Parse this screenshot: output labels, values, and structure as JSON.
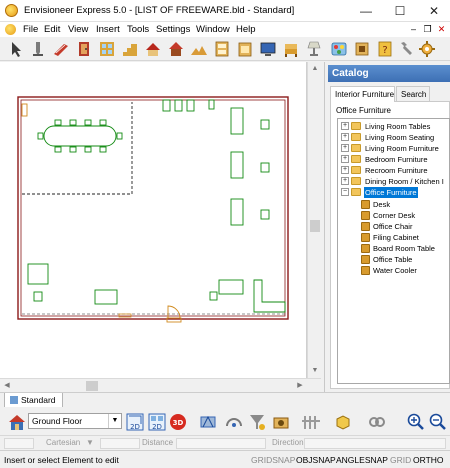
{
  "window": {
    "title": "Envisioneer Express 5.0 - [LIST OF FREEWARE.bld - Standard]",
    "minimize": "—",
    "maximize": "☐",
    "close": "✕"
  },
  "menu": {
    "items": [
      "File",
      "Edit",
      "View",
      "Insert",
      "Tools",
      "Settings",
      "Window",
      "Help"
    ],
    "mdi_min": "–",
    "mdi_restore": "❐",
    "mdi_close": "✕"
  },
  "toolbar": {
    "icons": [
      "select-arrow-icon",
      "pencil-icon",
      "wall-icon",
      "door-icon",
      "window-icon",
      "stairs-icon",
      "roof-icon",
      "terrain-icon",
      "cabinet-icon",
      "appliance-icon",
      "monitor-icon",
      "furniture-icon",
      "lamp-icon",
      "paint-icon",
      "help-icon",
      "tools-icon",
      "settings-icon"
    ]
  },
  "canvas": {
    "scroll_up": "▲",
    "scroll_down": "▼",
    "scroll_left": "◀",
    "scroll_right": "▶",
    "colors": {
      "wall": "#8b1a1a",
      "furniture": "#128a12",
      "door": "#d08a1e",
      "dashed": "#222222"
    }
  },
  "catalog": {
    "title": "Catalog",
    "tabs": [
      "Interior Furniture",
      "Search"
    ],
    "active_tab": "Interior Furniture",
    "path": "Office Furniture",
    "categories": [
      {
        "label": "Living Room Tables",
        "expanded": false
      },
      {
        "label": "Living Room Seating",
        "expanded": false
      },
      {
        "label": "Living Room Furniture",
        "expanded": false
      },
      {
        "label": "Bedroom Furniture",
        "expanded": false
      },
      {
        "label": "Recroom Furniture",
        "expanded": false
      },
      {
        "label": "Dining Room / Kitchen I",
        "expanded": false
      },
      {
        "label": "Office Furniture",
        "expanded": true,
        "selected": true
      }
    ],
    "items": [
      "Desk",
      "Corner Desk",
      "Office Chair",
      "Filing Cabinet",
      "Board Room Table",
      "Office Table",
      "Water Cooler"
    ],
    "expander_collapsed": "+",
    "expander_expanded": "−"
  },
  "floor_tabs": {
    "active": "Standard"
  },
  "bottom_toolbar": {
    "floor_select": "Ground Floor",
    "floor_select_arrow": "▼",
    "view_labels": [
      "2D",
      "2D",
      "3D"
    ]
  },
  "coords": {
    "mode": "Cartesian",
    "mode_arrow": "▼",
    "distance_label": "Distance",
    "direction_label": "Direction"
  },
  "status": {
    "message": "Insert or select Element to edit",
    "flags": [
      {
        "label": "GRIDSNAP",
        "on": false
      },
      {
        "label": "OBJSNAP",
        "on": true
      },
      {
        "label": "ANGLESNAP",
        "on": true
      },
      {
        "label": "GRID",
        "on": false
      },
      {
        "label": "ORTHO",
        "on": true
      }
    ]
  }
}
